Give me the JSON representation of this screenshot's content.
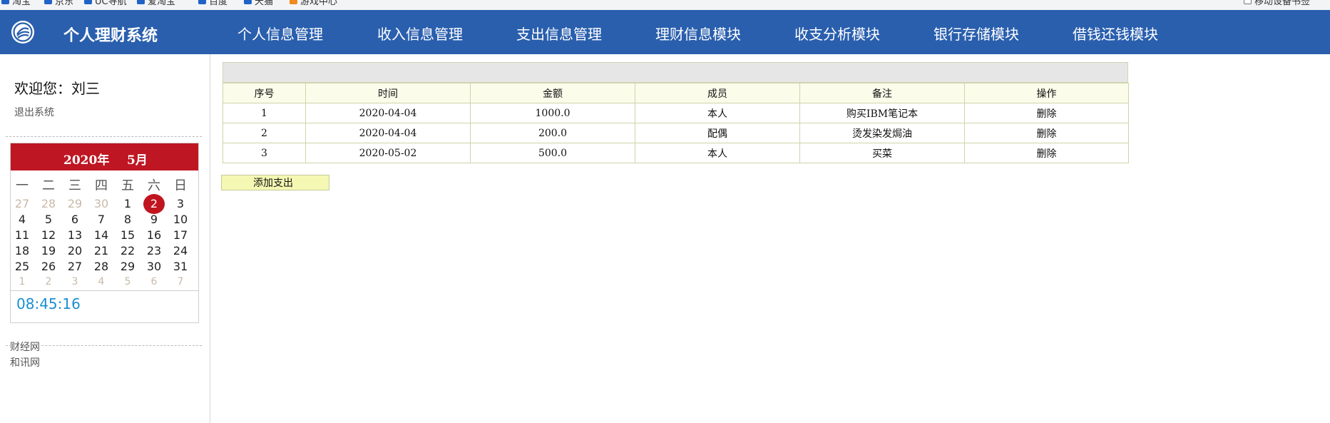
{
  "bookmarks": [
    "淘宝",
    "京东",
    "UC导航",
    "爱淘宝",
    "百度",
    "天猫",
    "游戏中心",
    "移动设备书签"
  ],
  "app": {
    "title": "个人理财系统"
  },
  "nav": [
    "个人信息管理",
    "收入信息管理",
    "支出信息管理",
    "理财信息模块",
    "收支分析模块",
    "银行存储模块",
    "借钱还钱模块"
  ],
  "sidebar": {
    "welcome": "欢迎您：刘三",
    "logout": "退出系统",
    "links": [
      "财经网",
      "和讯网"
    ]
  },
  "calendar": {
    "year_label": "2020年",
    "month_label": "5月",
    "weekdays": [
      "一",
      "二",
      "三",
      "四",
      "五",
      "六",
      "日"
    ],
    "weeks": [
      [
        "27",
        "28",
        "29",
        "30",
        "1",
        "2",
        "3"
      ],
      [
        "4",
        "5",
        "6",
        "7",
        "8",
        "9",
        "10"
      ],
      [
        "11",
        "12",
        "13",
        "14",
        "15",
        "16",
        "17"
      ],
      [
        "18",
        "19",
        "20",
        "21",
        "22",
        "23",
        "24"
      ],
      [
        "25",
        "26",
        "27",
        "28",
        "29",
        "30",
        "31"
      ],
      [
        "1",
        "2",
        "3",
        "4",
        "5",
        "6",
        "7"
      ]
    ],
    "today": "2",
    "time": "08:45:16",
    "colors": {
      "header": "#bf1623",
      "time": "#1b8fd2"
    }
  },
  "expenses": {
    "columns": [
      "序号",
      "时间",
      "金额",
      "成员",
      "备注",
      "操作"
    ],
    "rows": [
      {
        "id": "1",
        "date": "2020-04-04",
        "amount": "1000.0",
        "member": "本人",
        "note": "购买IBM笔记本",
        "action": "删除"
      },
      {
        "id": "2",
        "date": "2020-04-04",
        "amount": "200.0",
        "member": "配偶",
        "note": "烫发染发焗油",
        "action": "删除"
      },
      {
        "id": "3",
        "date": "2020-05-02",
        "amount": "500.0",
        "member": "本人",
        "note": "买菜",
        "action": "删除"
      }
    ],
    "add_label": "添加支出"
  },
  "theme": {
    "nav_bg": "#2a5fae"
  }
}
